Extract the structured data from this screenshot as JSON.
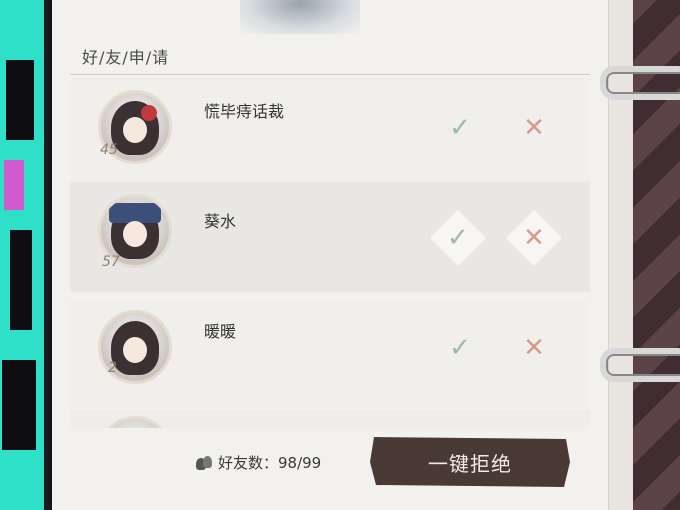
{
  "section_title": "好/友/申/请",
  "requests": [
    {
      "name": "慌毕痔话裁",
      "level": "45",
      "accept_icon": "check-icon",
      "reject_icon": "cross-icon"
    },
    {
      "name": "葵水",
      "level": "57",
      "accept_icon": "check-icon",
      "reject_icon": "cross-icon"
    },
    {
      "name": "暖暖",
      "level": "2",
      "accept_icon": "check-icon",
      "reject_icon": "cross-icon"
    }
  ],
  "accept_glyph": "✓",
  "reject_glyph": "✕",
  "footer": {
    "friend_count_label": "好友数：98/99",
    "reject_all_label": "一键拒绝"
  },
  "colors": {
    "accept": "#9fb8a7",
    "reject": "#d79a8c",
    "reject_all_bg": "#4a3a36",
    "banner_teal": "#2fe0c8"
  }
}
